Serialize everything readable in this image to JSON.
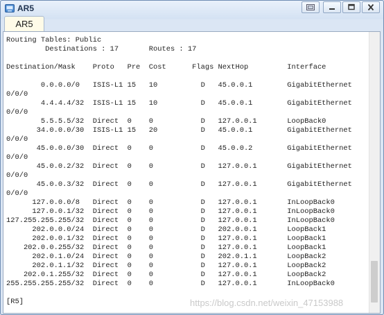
{
  "window": {
    "title": "AR5",
    "tab_label": "AR5",
    "icons": [
      "app-icon",
      "restore-icon",
      "minimize-icon",
      "maximize-icon",
      "close-icon"
    ]
  },
  "console": {
    "lines": [
      "Routing Tables: Public",
      "         Destinations : 17       Routes : 17",
      "",
      "Destination/Mask    Proto   Pre  Cost      Flags NextHop         Interface",
      "",
      "        0.0.0.0/0   ISIS-L1 15   10          D   45.0.0.1        GigabitEthernet",
      "0/0/0",
      "        4.4.4.4/32  ISIS-L1 15   10          D   45.0.0.1        GigabitEthernet",
      "0/0/0",
      "        5.5.5.5/32  Direct  0    0           D   127.0.0.1       LoopBack0",
      "       34.0.0.0/30  ISIS-L1 15   20          D   45.0.0.1        GigabitEthernet",
      "0/0/0",
      "       45.0.0.0/30  Direct  0    0           D   45.0.0.2        GigabitEthernet",
      "0/0/0",
      "       45.0.0.2/32  Direct  0    0           D   127.0.0.1       GigabitEthernet",
      "0/0/0",
      "       45.0.0.3/32  Direct  0    0           D   127.0.0.1       GigabitEthernet",
      "0/0/0",
      "      127.0.0.0/8   Direct  0    0           D   127.0.0.1       InLoopBack0",
      "      127.0.0.1/32  Direct  0    0           D   127.0.0.1       InLoopBack0",
      "127.255.255.255/32  Direct  0    0           D   127.0.0.1       InLoopBack0",
      "      202.0.0.0/24  Direct  0    0           D   202.0.0.1       LoopBack1",
      "      202.0.0.1/32  Direct  0    0           D   127.0.0.1       LoopBack1",
      "    202.0.0.255/32  Direct  0    0           D   127.0.0.1       LoopBack1",
      "      202.0.1.0/24  Direct  0    0           D   202.0.1.1       LoopBack2",
      "      202.0.1.1/32  Direct  0    0           D   127.0.0.1       LoopBack2",
      "    202.0.1.255/32  Direct  0    0           D   127.0.0.1       LoopBack2",
      "255.255.255.255/32  Direct  0    0           D   127.0.0.1       InLoopBack0",
      "",
      "[R5]"
    ]
  },
  "watermark": "https://blog.csdn.net/weixin_47153988"
}
